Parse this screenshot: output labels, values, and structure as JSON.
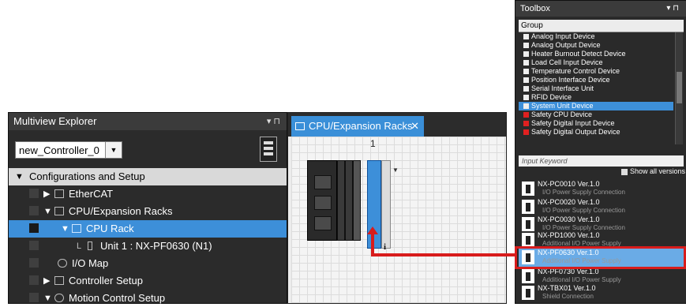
{
  "explorer": {
    "title": "Multiview Explorer",
    "pin": "▾ ⊓",
    "controller": "new_Controller_0",
    "tree": [
      {
        "label": "Configurations and Setup",
        "arrow": "▼",
        "icon": ""
      },
      {
        "label": "EtherCAT",
        "arrow": "▶",
        "icon": "ethercat-icon"
      },
      {
        "label": "CPU/Expansion Racks",
        "arrow": "▼",
        "icon": "rack-icon"
      },
      {
        "label": "CPU Rack",
        "arrow": "▼",
        "icon": "cpu-rack-icon"
      },
      {
        "label": "Unit 1 : NX-PF0630 (N1)",
        "arrow": "L",
        "icon": "unit-icon"
      },
      {
        "label": "I/O Map",
        "arrow": "",
        "icon": "io-map-icon"
      },
      {
        "label": "Controller Setup",
        "arrow": "▶",
        "icon": "controller-setup-icon"
      },
      {
        "label": "Motion Control Setup",
        "arrow": "▼",
        "icon": "gear-icon"
      }
    ]
  },
  "racks": {
    "tab_label": "CPU/Expansion Racks",
    "close": "✕",
    "slot": "1",
    "menu": "▼",
    "info": "i"
  },
  "toolbox": {
    "title": "Toolbox",
    "pin": "▾ ⊓",
    "group_header": "Group",
    "groups": [
      {
        "label": "Analog Input Device",
        "red": false
      },
      {
        "label": "Analog Output Device",
        "red": false
      },
      {
        "label": "Heater Burnout Detect Device",
        "red": false
      },
      {
        "label": "Load Cell Input Device",
        "red": false
      },
      {
        "label": "Temperature Control Device",
        "red": false
      },
      {
        "label": "Position Interface Device",
        "red": false
      },
      {
        "label": "Serial Interface Unit",
        "red": false
      },
      {
        "label": "RFID Device",
        "red": false
      },
      {
        "label": "System Unit Device",
        "red": false,
        "selected": true
      },
      {
        "label": "Safety CPU Device",
        "red": true
      },
      {
        "label": "Safety Digital Input Device",
        "red": true
      },
      {
        "label": "Safety Digital Output Device",
        "red": true
      }
    ],
    "keyword_placeholder": "Input Keyword",
    "show_all": "Show all versions",
    "units": [
      {
        "name": "NX-PC0010 Ver.1.0",
        "desc": "I/O Power Supply Connection"
      },
      {
        "name": "NX-PC0020 Ver.1.0",
        "desc": "I/O Power Supply Connection"
      },
      {
        "name": "NX-PC0030 Ver.1.0",
        "desc": "I/O Power Supply Connection"
      },
      {
        "name": "NX-PD1000 Ver.1.0",
        "desc": "Additional I/O Power Supply"
      },
      {
        "name": "NX-PF0630 Ver.1.0",
        "desc": "Additional I/O Power Supply",
        "selected": true
      },
      {
        "name": "NX-PF0730 Ver.1.0",
        "desc": "Additional I/O Power Supply"
      },
      {
        "name": "NX-TBX01 Ver.1.0",
        "desc": "Shield Connection"
      }
    ]
  },
  "colors": {
    "accent": "#3d8fd9",
    "highlight": "#d81c1c",
    "panel": "#2b2b2b"
  }
}
